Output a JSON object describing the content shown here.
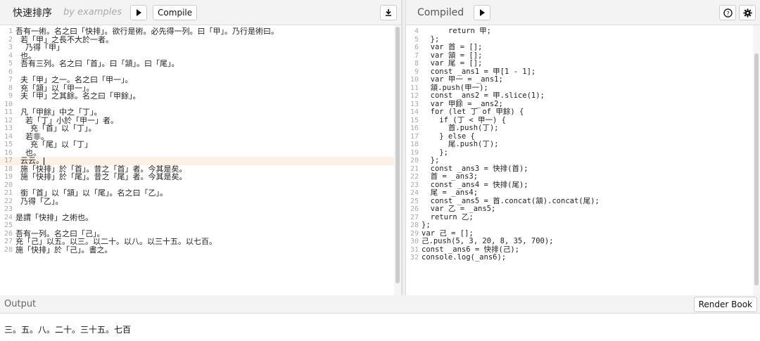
{
  "editor": {
    "title": "快速排序",
    "subtitle": "by examples",
    "compile_label": "Compile",
    "lines": [
      {
        "n": "1",
        "t": "吾有一術。名之曰「快排」。欲行是術。必先得一列。曰「甲」。乃行是術曰。"
      },
      {
        "n": "2",
        "t": "  若「甲」之長不大於一者。"
      },
      {
        "n": "3",
        "t": "    乃得「甲」"
      },
      {
        "n": "4",
        "t": "  也。"
      },
      {
        "n": "5",
        "t": "  吾有三列。名之曰「首」。曰「頷」。曰「尾」。"
      },
      {
        "n": "6",
        "t": ""
      },
      {
        "n": "7",
        "t": "  夫「甲」之一。名之曰「甲一」。"
      },
      {
        "n": "8",
        "t": "  充「頷」以「甲一」。"
      },
      {
        "n": "9",
        "t": "  夫「甲」之其餘。名之曰「甲餘」。"
      },
      {
        "n": "10",
        "t": ""
      },
      {
        "n": "11",
        "t": "  凡「甲餘」中之「丁」。"
      },
      {
        "n": "12",
        "t": "    若「丁」小於「甲一」者。"
      },
      {
        "n": "13",
        "t": "      充「首」以「丁」。"
      },
      {
        "n": "14",
        "t": "    若非。"
      },
      {
        "n": "15",
        "t": "      充「尾」以「丁」"
      },
      {
        "n": "16",
        "t": "    也。"
      },
      {
        "n": "17",
        "t": "  云云。"
      },
      {
        "n": "18",
        "t": "  施「快排」於「首」。昔之「首」者。今其是矣。"
      },
      {
        "n": "19",
        "t": "  施「快排」於「尾」。昔之「尾」者。今其是矣。"
      },
      {
        "n": "20",
        "t": ""
      },
      {
        "n": "21",
        "t": "  銜「首」以「頷」以「尾」。名之曰「乙」。"
      },
      {
        "n": "22",
        "t": "  乃得「乙」。"
      },
      {
        "n": "23",
        "t": ""
      },
      {
        "n": "24",
        "t": "是謂「快排」之術也。"
      },
      {
        "n": "25",
        "t": ""
      },
      {
        "n": "26",
        "t": "吾有一列。名之曰「己」。"
      },
      {
        "n": "27",
        "t": "充「己」以五。以三。以二十。以八。以三十五。以七百。"
      },
      {
        "n": "28",
        "t": "施「快排」於「己」。書之。"
      }
    ]
  },
  "compiled": {
    "title": "Compiled",
    "help_icon": "help-circle-icon",
    "settings_icon": "gear-icon",
    "lines": [
      {
        "n": "4",
        "t": "      return 甲;"
      },
      {
        "n": "5",
        "t": "  };"
      },
      {
        "n": "6",
        "t": "  var 首 = [];"
      },
      {
        "n": "7",
        "t": "  var 頷 = [];"
      },
      {
        "n": "8",
        "t": "  var 尾 = [];"
      },
      {
        "n": "9",
        "t": "  const _ans1 = 甲[1 - 1];"
      },
      {
        "n": "10",
        "t": "  var 甲一 = _ans1;"
      },
      {
        "n": "11",
        "t": "  頷.push(甲一);"
      },
      {
        "n": "12",
        "t": "  const _ans2 = 甲.slice(1);"
      },
      {
        "n": "13",
        "t": "  var 甲餘 = _ans2;"
      },
      {
        "n": "14",
        "t": "  for (let 丁 of 甲餘) {"
      },
      {
        "n": "15",
        "t": "    if (丁 < 甲一) {"
      },
      {
        "n": "16",
        "t": "      首.push(丁);"
      },
      {
        "n": "17",
        "t": "    } else {"
      },
      {
        "n": "18",
        "t": "      尾.push(丁);"
      },
      {
        "n": "19",
        "t": "    };"
      },
      {
        "n": "20",
        "t": "  };"
      },
      {
        "n": "21",
        "t": "  const _ans3 = 快排(首);"
      },
      {
        "n": "22",
        "t": "  首 = _ans3;"
      },
      {
        "n": "23",
        "t": "  const _ans4 = 快排(尾);"
      },
      {
        "n": "24",
        "t": "  尾 = _ans4;"
      },
      {
        "n": "25",
        "t": "  const _ans5 = 首.concat(頷).concat(尾);"
      },
      {
        "n": "26",
        "t": "  var 乙 = _ans5;"
      },
      {
        "n": "27",
        "t": "  return 乙;"
      },
      {
        "n": "28",
        "t": "};"
      },
      {
        "n": "29",
        "t": "var 己 = [];"
      },
      {
        "n": "30",
        "t": "己.push(5, 3, 20, 8, 35, 700);"
      },
      {
        "n": "31",
        "t": "const _ans6 = 快排(己);"
      },
      {
        "n": "32",
        "t": "console.log(_ans6);"
      }
    ]
  },
  "output": {
    "title": "Output",
    "render_book_label": "Render Book",
    "text": "三。五。八。二十。三十五。七百"
  }
}
